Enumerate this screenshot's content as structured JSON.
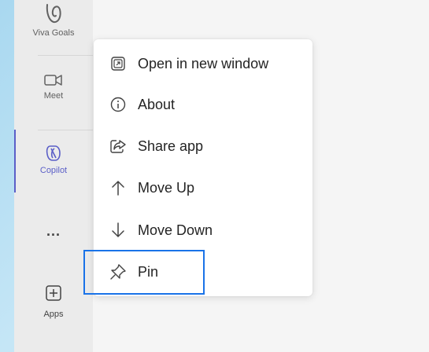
{
  "rail": {
    "items": [
      {
        "label": "Viva Goals",
        "icon": "viva-goals-icon"
      },
      {
        "label": "Meet",
        "icon": "video-camera-icon"
      },
      {
        "label": "Copilot",
        "icon": "copilot-icon",
        "active": true
      },
      {
        "label": "...",
        "icon": "more-icon"
      },
      {
        "label": "Apps",
        "icon": "add-apps-icon"
      }
    ]
  },
  "context_menu": {
    "items": [
      {
        "label": "Open in new window",
        "icon": "open-new-window-icon"
      },
      {
        "label": "About",
        "icon": "info-icon"
      },
      {
        "label": "Share app",
        "icon": "share-icon"
      },
      {
        "label": "Move Up",
        "icon": "arrow-up-icon"
      },
      {
        "label": "Move Down",
        "icon": "arrow-down-icon"
      },
      {
        "label": "Pin",
        "icon": "pin-icon",
        "highlighted": true
      }
    ]
  },
  "colors": {
    "accent": "#5b5fc7",
    "highlight_border": "#1a73e8"
  }
}
